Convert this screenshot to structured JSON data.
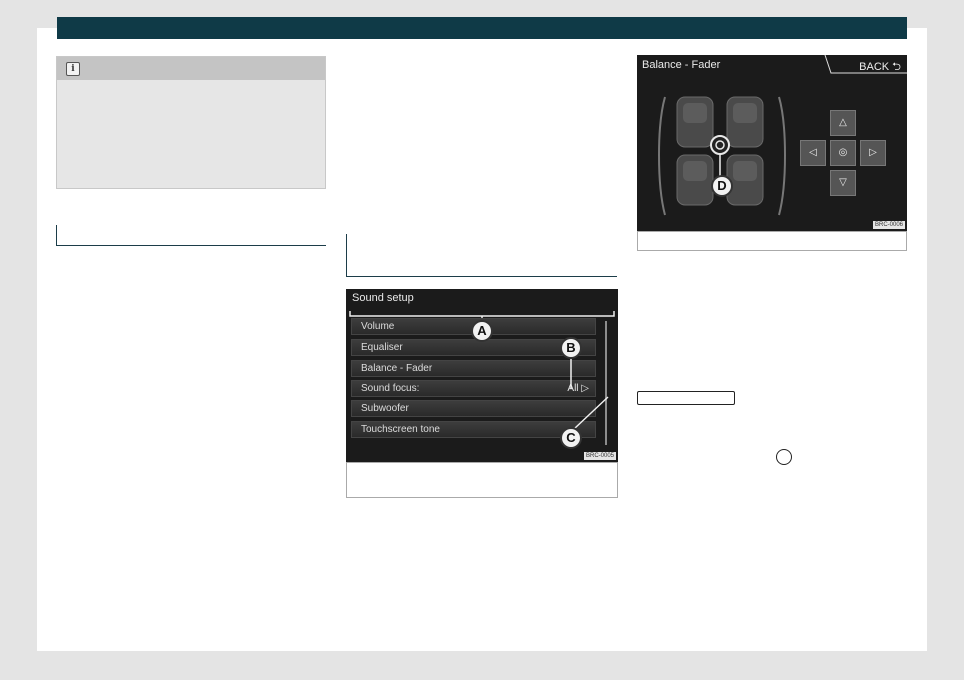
{
  "note": {
    "icon": "info-icon",
    "icon_glyph": "i"
  },
  "figure1": {
    "title": "Sound setup",
    "menu_items": [
      {
        "label": "Volume",
        "value": ""
      },
      {
        "label": "Equaliser",
        "value": ""
      },
      {
        "label": "Balance - Fader",
        "value": ""
      },
      {
        "label": "Sound focus:",
        "value": "All ▷"
      },
      {
        "label": "Subwoofer",
        "value": ""
      },
      {
        "label": "Touchscreen tone",
        "value": ""
      }
    ],
    "callouts": {
      "a": "A",
      "b": "B",
      "c": "C"
    },
    "code": "BRC-0005"
  },
  "figure2": {
    "title": "Balance - Fader",
    "back_label": "BACK ⮌",
    "callout_d": "D",
    "dpad": {
      "up": "△",
      "down": "▽",
      "left": "◁",
      "right": "▷",
      "center": "◎"
    },
    "code": "BRC-0006"
  },
  "colors": {
    "header": "#0f3a47",
    "rule": "#1c3d49",
    "screen_bg": "#1b1b1b"
  }
}
